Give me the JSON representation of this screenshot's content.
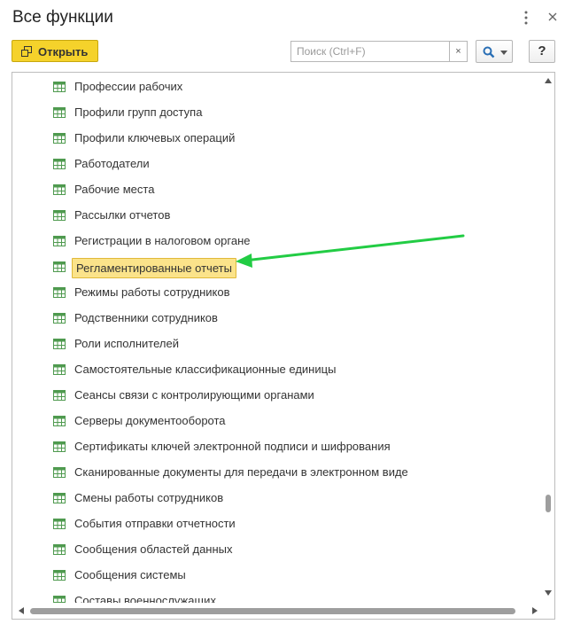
{
  "window": {
    "title": "Все функции"
  },
  "toolbar": {
    "open_label": "Открыть",
    "search_placeholder": "Поиск (Ctrl+F)",
    "search_value": "",
    "clear_label": "×",
    "help_label": "?"
  },
  "list": {
    "items": [
      "Профессии рабочих",
      "Профили групп доступа",
      "Профили ключевых операций",
      "Работодатели",
      "Рабочие места",
      "Рассылки отчетов",
      "Регистрации в налоговом органе",
      "Регламентированные отчеты",
      "Режимы работы сотрудников",
      "Родственники сотрудников",
      "Роли исполнителей",
      "Самостоятельные классификационные единицы",
      "Сеансы связи с контролирующими органами",
      "Серверы документооборота",
      "Сертификаты ключей электронной подписи и шифрования",
      "Сканированные документы для передачи в электронном виде",
      "Смены работы сотрудников",
      "События отправки отчетности",
      "Сообщения областей данных",
      "Сообщения системы",
      "Составы военнослужащих"
    ],
    "selected_index": 7
  },
  "icons": {
    "row": "table-icon",
    "open": "open-window-icon",
    "search": "magnifier-icon",
    "more": "more-vertical-icon",
    "close": "close-icon",
    "arrow": "green-arrow-annotation"
  },
  "colors": {
    "accent_button": "#f5d22b",
    "selection": "#fbe38a",
    "annotation_arrow": "#22cc44",
    "row_icon": "#4f9a4f"
  }
}
